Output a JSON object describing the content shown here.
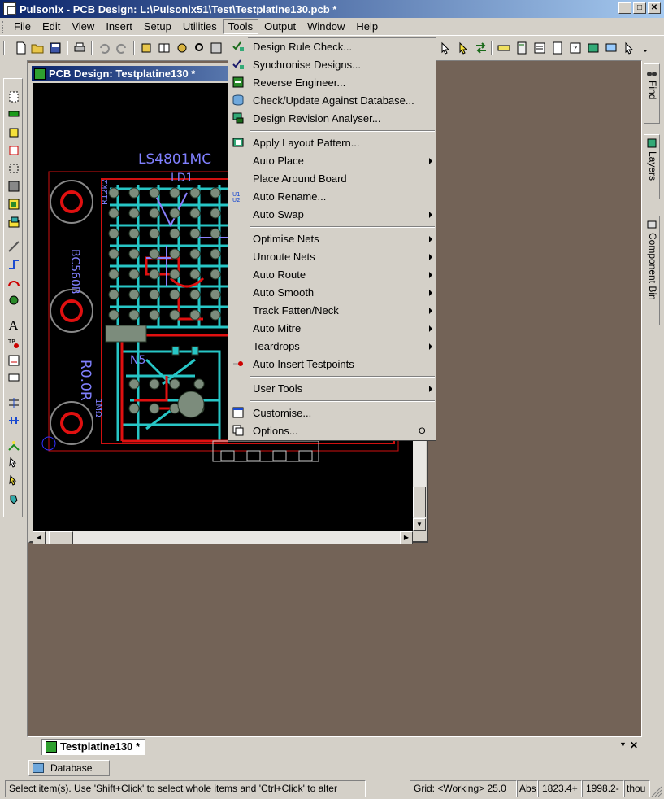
{
  "window": {
    "title": "Pulsonix - PCB Design: L:\\Pulsonix51\\Test\\Testplatine130.pcb *",
    "min": "_",
    "max": "□",
    "close": "✕"
  },
  "menubar": {
    "items": [
      "File",
      "Edit",
      "View",
      "Insert",
      "Setup",
      "Utilities",
      "Tools",
      "Output",
      "Window",
      "Help"
    ],
    "active": "Tools"
  },
  "pcb_window": {
    "title": "PCB Design: Testplatine130 *",
    "silk_labels": [
      "LS4801MC",
      "LD1",
      "BC560B",
      "R0.0R",
      "R12k2",
      "1MΩ",
      "N5"
    ]
  },
  "tools_menu": {
    "items": [
      {
        "label": "Design Rule Check...",
        "icon": "drc-icon",
        "submenu": false
      },
      {
        "label": "Synchronise Designs...",
        "icon": "sync-icon",
        "submenu": false
      },
      {
        "label": "Reverse Engineer...",
        "icon": "reverse-icon",
        "submenu": false
      },
      {
        "label": "Check/Update Against Database...",
        "icon": "database-check-icon",
        "submenu": false
      },
      {
        "label": "Design Revision Analyser...",
        "icon": "revision-icon",
        "submenu": false
      },
      {
        "label": "Apply Layout Pattern...",
        "icon": "pattern-icon",
        "submenu": false
      },
      {
        "label": "Auto Place",
        "icon": "",
        "submenu": true
      },
      {
        "label": "Place Around Board",
        "icon": "",
        "submenu": false
      },
      {
        "label": "Auto Rename...",
        "icon": "rename-icon",
        "submenu": false
      },
      {
        "label": "Auto Swap",
        "icon": "",
        "submenu": true
      },
      {
        "label": "Optimise Nets",
        "icon": "",
        "submenu": true
      },
      {
        "label": "Unroute Nets",
        "icon": "",
        "submenu": true
      },
      {
        "label": "Auto Route",
        "icon": "",
        "submenu": true
      },
      {
        "label": "Auto Smooth",
        "icon": "",
        "submenu": true
      },
      {
        "label": "Track Fatten/Neck",
        "icon": "",
        "submenu": true
      },
      {
        "label": "Auto Mitre",
        "icon": "",
        "submenu": true
      },
      {
        "label": "Teardrops",
        "icon": "",
        "submenu": true
      },
      {
        "label": "Auto Insert Testpoints",
        "icon": "testpoint-icon",
        "submenu": false
      },
      {
        "label": "User Tools",
        "icon": "",
        "submenu": true
      },
      {
        "label": "Customise...",
        "icon": "customise-icon",
        "submenu": false
      },
      {
        "label": "Options...",
        "icon": "options-icon",
        "submenu": false,
        "shortcut": "O"
      }
    ]
  },
  "right_docks": [
    "Find",
    "Layers",
    "Component Bin"
  ],
  "doc_tab": {
    "label": "Testplatine130 *",
    "close": "✕"
  },
  "db_tab": {
    "label": "Database"
  },
  "status": {
    "hint": "Select item(s). Use 'Shift+Click' to select whole items and 'Ctrl+Click' to alter",
    "grid": "Grid: <Working> 25.0",
    "mode": "Abs",
    "x": "1823.4+",
    "y": "1998.2-",
    "units": "thou"
  },
  "colors": {
    "titlebar_start": "#0a246a",
    "titlebar_end": "#a6caf0",
    "mdi_bg": "#736357",
    "track_cyan": "#27c6c6",
    "track_red": "#e01010",
    "pad_gray": "#7c8c7c",
    "silk": "#8080ff"
  }
}
